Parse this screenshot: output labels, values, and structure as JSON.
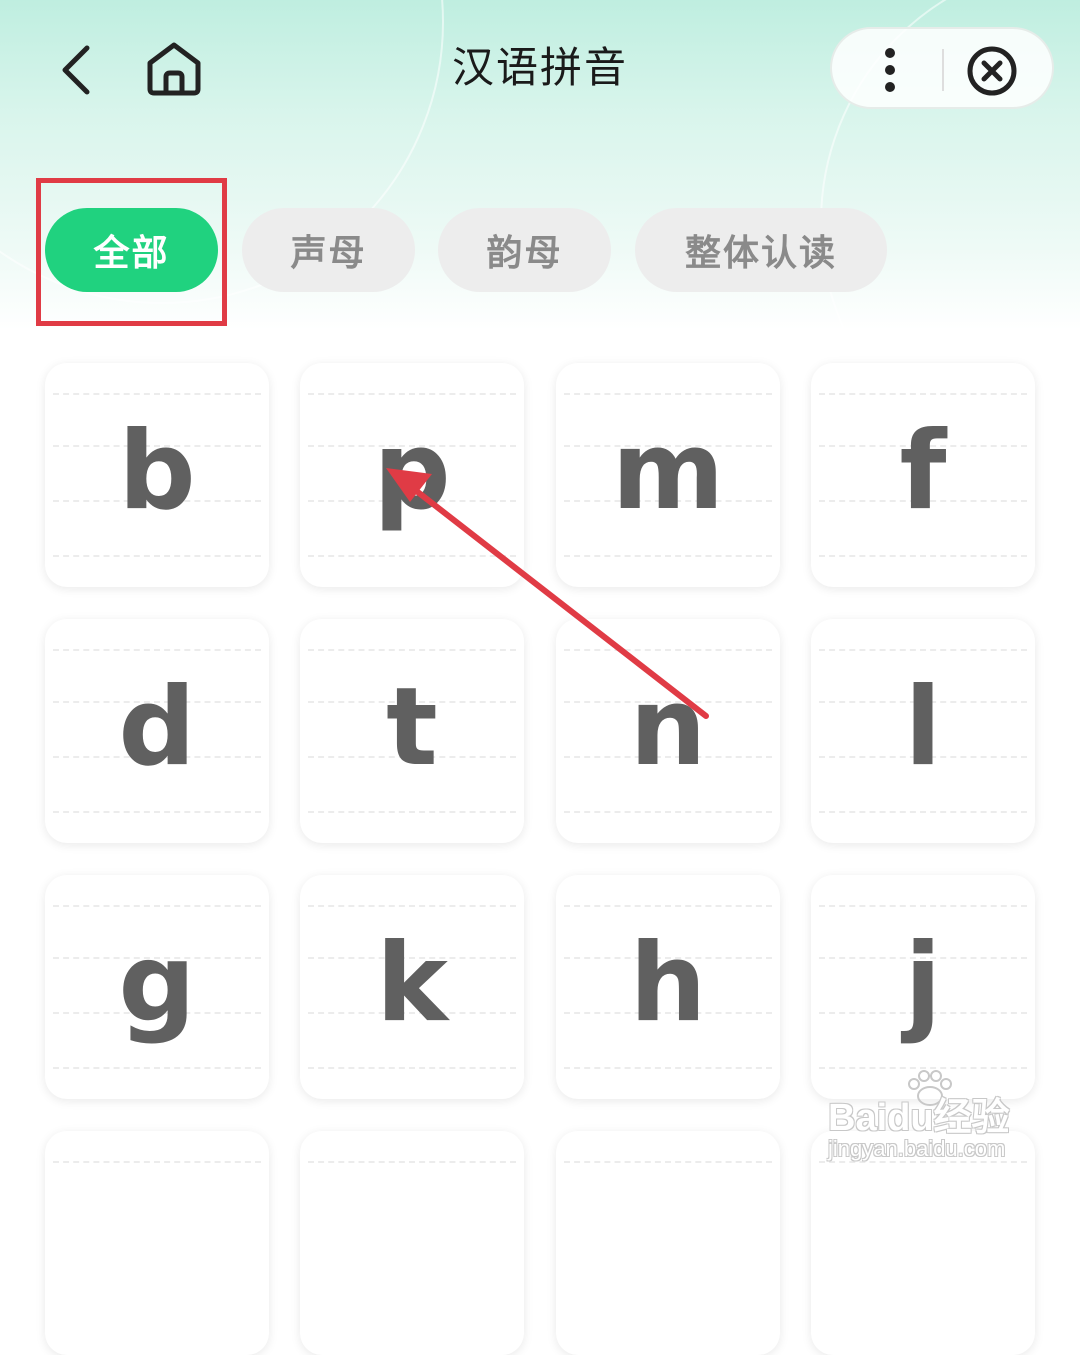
{
  "header": {
    "title": "汉语拼音",
    "back_icon": "chevron-left-icon",
    "home_icon": "home-icon",
    "more_icon": "more-vertical-icon",
    "close_icon": "close-circle-icon"
  },
  "tabs": [
    {
      "label": "全部",
      "active": true
    },
    {
      "label": "声母",
      "active": false
    },
    {
      "label": "韵母",
      "active": false
    },
    {
      "label": "整体认读",
      "active": false
    }
  ],
  "letters": [
    "b",
    "p",
    "m",
    "f",
    "d",
    "t",
    "n",
    "l",
    "g",
    "k",
    "h",
    "j",
    "",
    "",
    "",
    ""
  ],
  "annotation": {
    "box_color": "#e03b45",
    "arrow_color": "#e03b45"
  },
  "watermark": {
    "brand": "Baidu经验",
    "url": "jingyan.baidu.com"
  },
  "colors": {
    "accent": "#20d27f",
    "letter": "#606060",
    "tab_inactive_bg": "#ededed"
  }
}
